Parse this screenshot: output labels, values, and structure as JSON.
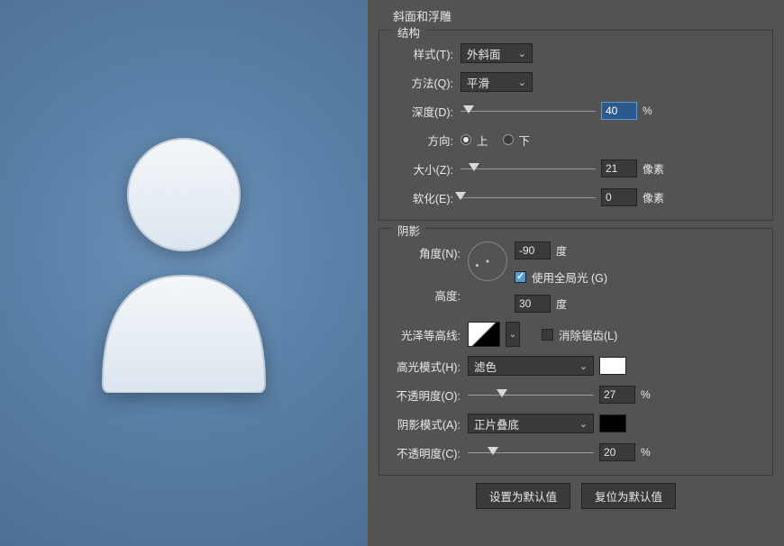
{
  "effect_title": "斜面和浮雕",
  "structure": {
    "title": "结构",
    "style": {
      "label": "样式(T):",
      "value": "外斜面"
    },
    "technique": {
      "label": "方法(Q):",
      "value": "平滑"
    },
    "depth": {
      "label": "深度(D):",
      "value": "40",
      "unit": "%",
      "pct": 6
    },
    "direction": {
      "label": "方向:",
      "up": "上",
      "down": "下",
      "checked": "up"
    },
    "size": {
      "label": "大小(Z):",
      "value": "21",
      "unit": "像素",
      "pct": 10
    },
    "soften": {
      "label": "软化(E):",
      "value": "0",
      "unit": "像素",
      "pct": 0
    }
  },
  "shading": {
    "title": "阴影",
    "angle": {
      "label": "角度(N):",
      "value": "-90",
      "unit": "度"
    },
    "global_light": {
      "label": "使用全局光 (G)",
      "checked": true
    },
    "altitude": {
      "label": "高度:",
      "value": "30",
      "unit": "度"
    },
    "contour": {
      "label": "光泽等高线:"
    },
    "antialias": {
      "label": "消除锯齿(L)",
      "checked": false
    },
    "highlight_mode": {
      "label": "高光模式(H):",
      "value": "滤色",
      "color": "#ffffff"
    },
    "highlight_opacity": {
      "label": "不透明度(O):",
      "value": "27",
      "unit": "%",
      "pct": 27
    },
    "shadow_mode": {
      "label": "阴影模式(A):",
      "value": "正片叠底",
      "color": "#000000"
    },
    "shadow_opacity": {
      "label": "不透明度(C):",
      "value": "20",
      "unit": "%",
      "pct": 20
    }
  },
  "buttons": {
    "default": "设置为默认值",
    "reset": "复位为默认值"
  }
}
